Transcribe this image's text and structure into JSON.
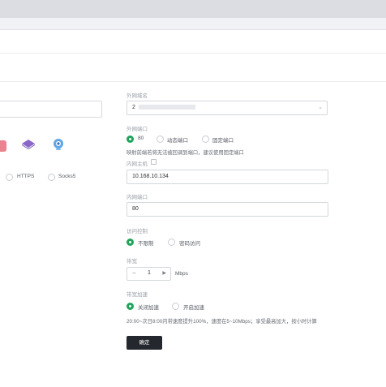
{
  "form": {
    "access_domain_label": "外网域名",
    "access_domain_value": "2",
    "external_port_label": "外网端口",
    "port_options": [
      "80",
      "动态端口",
      "固定端口"
    ],
    "port_hint": "映射前端若将无法被回调到端口，建议使用固定端口",
    "internal_host_label": "内网主机",
    "internal_host_value": "10.168.10.134",
    "internal_port_label": "内网端口",
    "internal_port_value": "80",
    "access_control_label": "访问控制",
    "access_options": [
      "不限制",
      "密码访问"
    ],
    "bandwidth_label": "带宽",
    "bandwidth_value": "1",
    "bandwidth_unit": "Mbps",
    "accel_label": "带宽加速",
    "accel_options": [
      "关闭加速",
      "开启加速"
    ],
    "accel_note": "20:00~次日8:00内带速度提升100%，速度在5~10Mbps；享受最高加大，按小时计算",
    "confirm_label": "确定"
  },
  "protocols": {
    "https": "HTTPS",
    "socks5": "Socks5"
  },
  "colors": {
    "accent": "#1ea45a",
    "primary_button": "#24272d"
  }
}
